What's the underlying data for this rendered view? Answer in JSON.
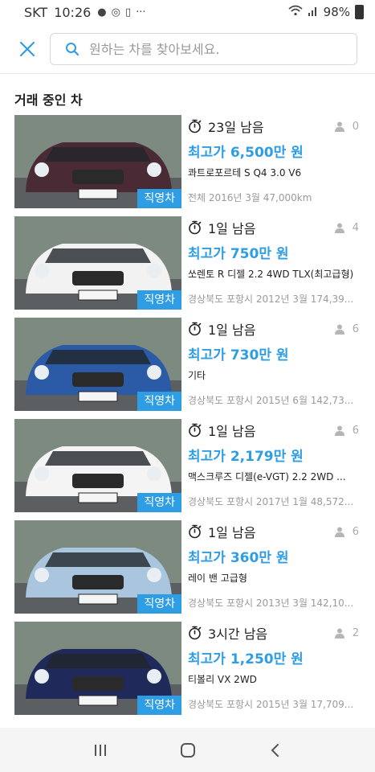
{
  "status": {
    "carrier": "SKT",
    "time": "10:26",
    "battery": "98%"
  },
  "search": {
    "placeholder": "원하는 차를 찾아보세요."
  },
  "section_title": "거래 중인 차",
  "items": [
    {
      "remaining": "23일 남음",
      "bidders": "0",
      "price": "최고가 6,500만 원",
      "model": "콰트로포르테 S Q4 3.0 V6",
      "meta": "전체  2016년 3월 47,000km",
      "badge": "직영차",
      "car_color": "#4a2a35"
    },
    {
      "remaining": "1일 남음",
      "bidders": "4",
      "price": "최고가 750만 원",
      "model": "쏘렌토 R 디젤 2.2 4WD TLX(최고급형)",
      "meta": "경상북도 포항시 2012년 3월 174,39...",
      "badge": "직영차",
      "car_color": "#f2f2f2"
    },
    {
      "remaining": "1일 남음",
      "bidders": "6",
      "price": "최고가 730만 원",
      "model": "기타",
      "meta": "경상북도 포항시 2015년 6월 142,73...",
      "badge": "직영차",
      "car_color": "#2b5aa6"
    },
    {
      "remaining": "1일 남음",
      "bidders": "6",
      "price": "최고가 2,179만 원",
      "model": "맥스크루즈 디젤(e-VGT) 2.2 2WD ...",
      "meta": "경상북도 포항시 2017년 1월 48,572...",
      "badge": "직영차",
      "car_color": "#f4f4f4"
    },
    {
      "remaining": "1일 남음",
      "bidders": "6",
      "price": "최고가 360만 원",
      "model": "레이 밴 고급형",
      "meta": "경상북도 포항시 2013년 3월 142,10...",
      "badge": "직영차",
      "car_color": "#a9c6de"
    },
    {
      "remaining": "3시간 남음",
      "bidders": "2",
      "price": "최고가 1,250만 원",
      "model": "티볼리 VX 2WD",
      "meta": "경상북도 포항시 2015년 3월 17,709...",
      "badge": "직영차",
      "car_color": "#1f2a5a"
    }
  ],
  "icons": {
    "close": "close-icon",
    "search": "search-icon",
    "timer": "stopwatch-icon",
    "user": "person-icon",
    "nav_recent": "recent-apps-icon",
    "nav_home": "home-icon",
    "nav_back": "back-icon"
  },
  "colors": {
    "accent": "#2f9de3",
    "muted": "#9a9a9a"
  }
}
